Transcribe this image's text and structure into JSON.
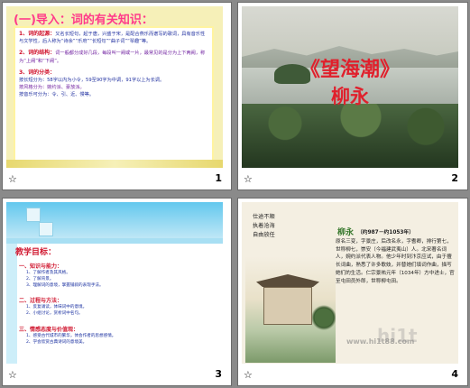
{
  "slides": [
    {
      "number": "1",
      "star": "☆",
      "title": "(一)导入：词的有关知识：",
      "sec1_head": "1、词的起源：",
      "sec1_body": "又名长短句，起于唐，兴盛于宋，是配合燕乐而谱写的歌词，具有音乐性与文学性，后人称为“诗余”“乐府”“长短句”“曲子词”“琴趣”等。",
      "sec2_head": "2、词的结构：",
      "sec2_body": "词一般都分成好几段，每段叫一阙或一片，最常见的是分为上下两阙，称为“上阙”和“下阙”。",
      "sec3_head": "3、词的分类：",
      "sec3_line1": "按长短分为：58字以内为小令，59至90字为中调，91字以上为长调。",
      "sec3_line2": "按风格分为：婉约派、豪放派。",
      "sec3_line3": "按音乐可分为：令、引、近、慢等。"
    },
    {
      "number": "2",
      "star": "☆",
      "title_line1": "《望海潮》",
      "title_line2": "柳永"
    },
    {
      "number": "3",
      "star": "☆",
      "title": "教学目标：",
      "sections": [
        {
          "head": "一、知识与能力：",
          "items": [
            "1、了解作者及其风格。",
            "2、了解背景。",
            "3、理解词的意境，掌握铺叙的表现手法。"
          ]
        },
        {
          "head": "二、过程与方法：",
          "items": [
            "1、反复诵读，体味词中的意境。",
            "2、小组讨论，赏析词中名句。"
          ]
        },
        {
          "head": "三、情感态度与价值观：",
          "items": [
            "1、感受古代城市的繁华，体会作者的思想感情。",
            "2、学会欣赏古典诗词的意境美。"
          ]
        }
      ]
    },
    {
      "number": "4",
      "star": "☆",
      "poem_lines": [
        "仕途不顺",
        "执着沧海",
        "自由放任"
      ],
      "author_name": "柳永",
      "author_dates": "（约987－约1053年）",
      "bio": "原名三变，字景庄，后改名永，字耆卿，排行第七，世称柳七，崇安（今福建武夷山）人。北宋著名词人，婉约派代表人物。他少年时到汴京应试，由于擅长词曲，熟悉了许多歌妓，并替她们填词作曲，描写她们的生活。仁宗景祐元年（1034年）方中进士，官至屯田员外郎，世称柳屯田。",
      "watermark": "www.hi1t88.com"
    }
  ]
}
